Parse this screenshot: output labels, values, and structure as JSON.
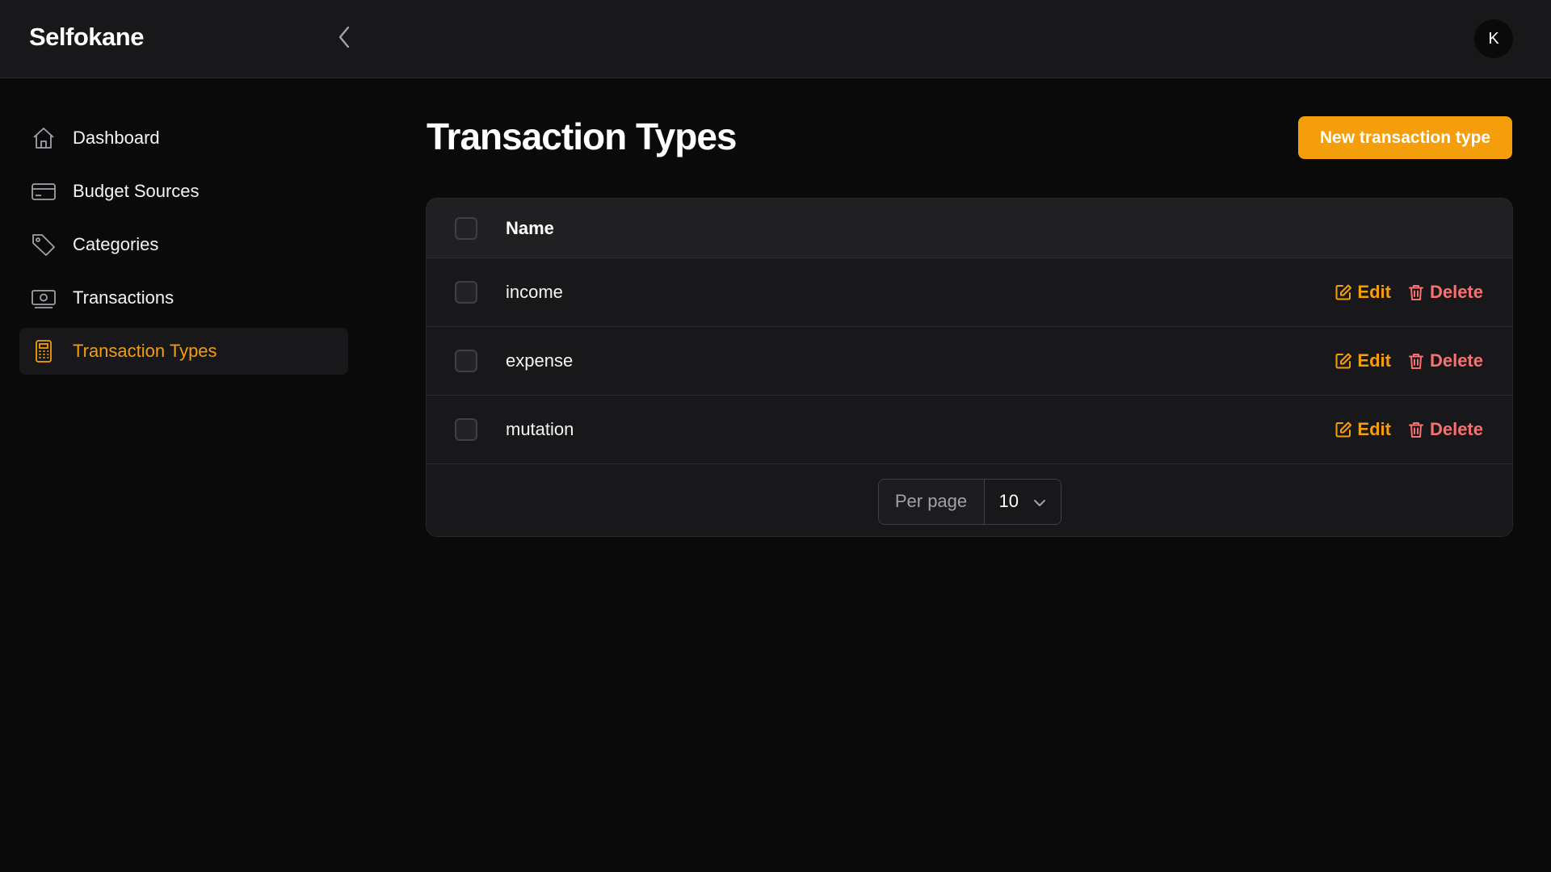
{
  "app": {
    "brand": "Selfokane",
    "avatar_initial": "K"
  },
  "colors": {
    "accent": "#f59e0b",
    "danger": "#f87171",
    "background": "#0a0a0b",
    "surface": "#18181b"
  },
  "sidebar": {
    "items": [
      {
        "label": "Dashboard",
        "icon": "home-icon",
        "active": false
      },
      {
        "label": "Budget Sources",
        "icon": "credit-card-icon",
        "active": false
      },
      {
        "label": "Categories",
        "icon": "tag-icon",
        "active": false
      },
      {
        "label": "Transactions",
        "icon": "banknote-icon",
        "active": false
      },
      {
        "label": "Transaction Types",
        "icon": "calculator-icon",
        "active": true
      }
    ]
  },
  "main": {
    "title": "Transaction Types",
    "new_button_label": "New transaction type",
    "table": {
      "columns": [
        "Name"
      ],
      "rows": [
        {
          "name": "income"
        },
        {
          "name": "expense"
        },
        {
          "name": "mutation"
        }
      ],
      "row_actions": {
        "edit": "Edit",
        "delete": "Delete"
      },
      "pagination": {
        "per_page_label": "Per page",
        "per_page_value": "10"
      }
    }
  }
}
